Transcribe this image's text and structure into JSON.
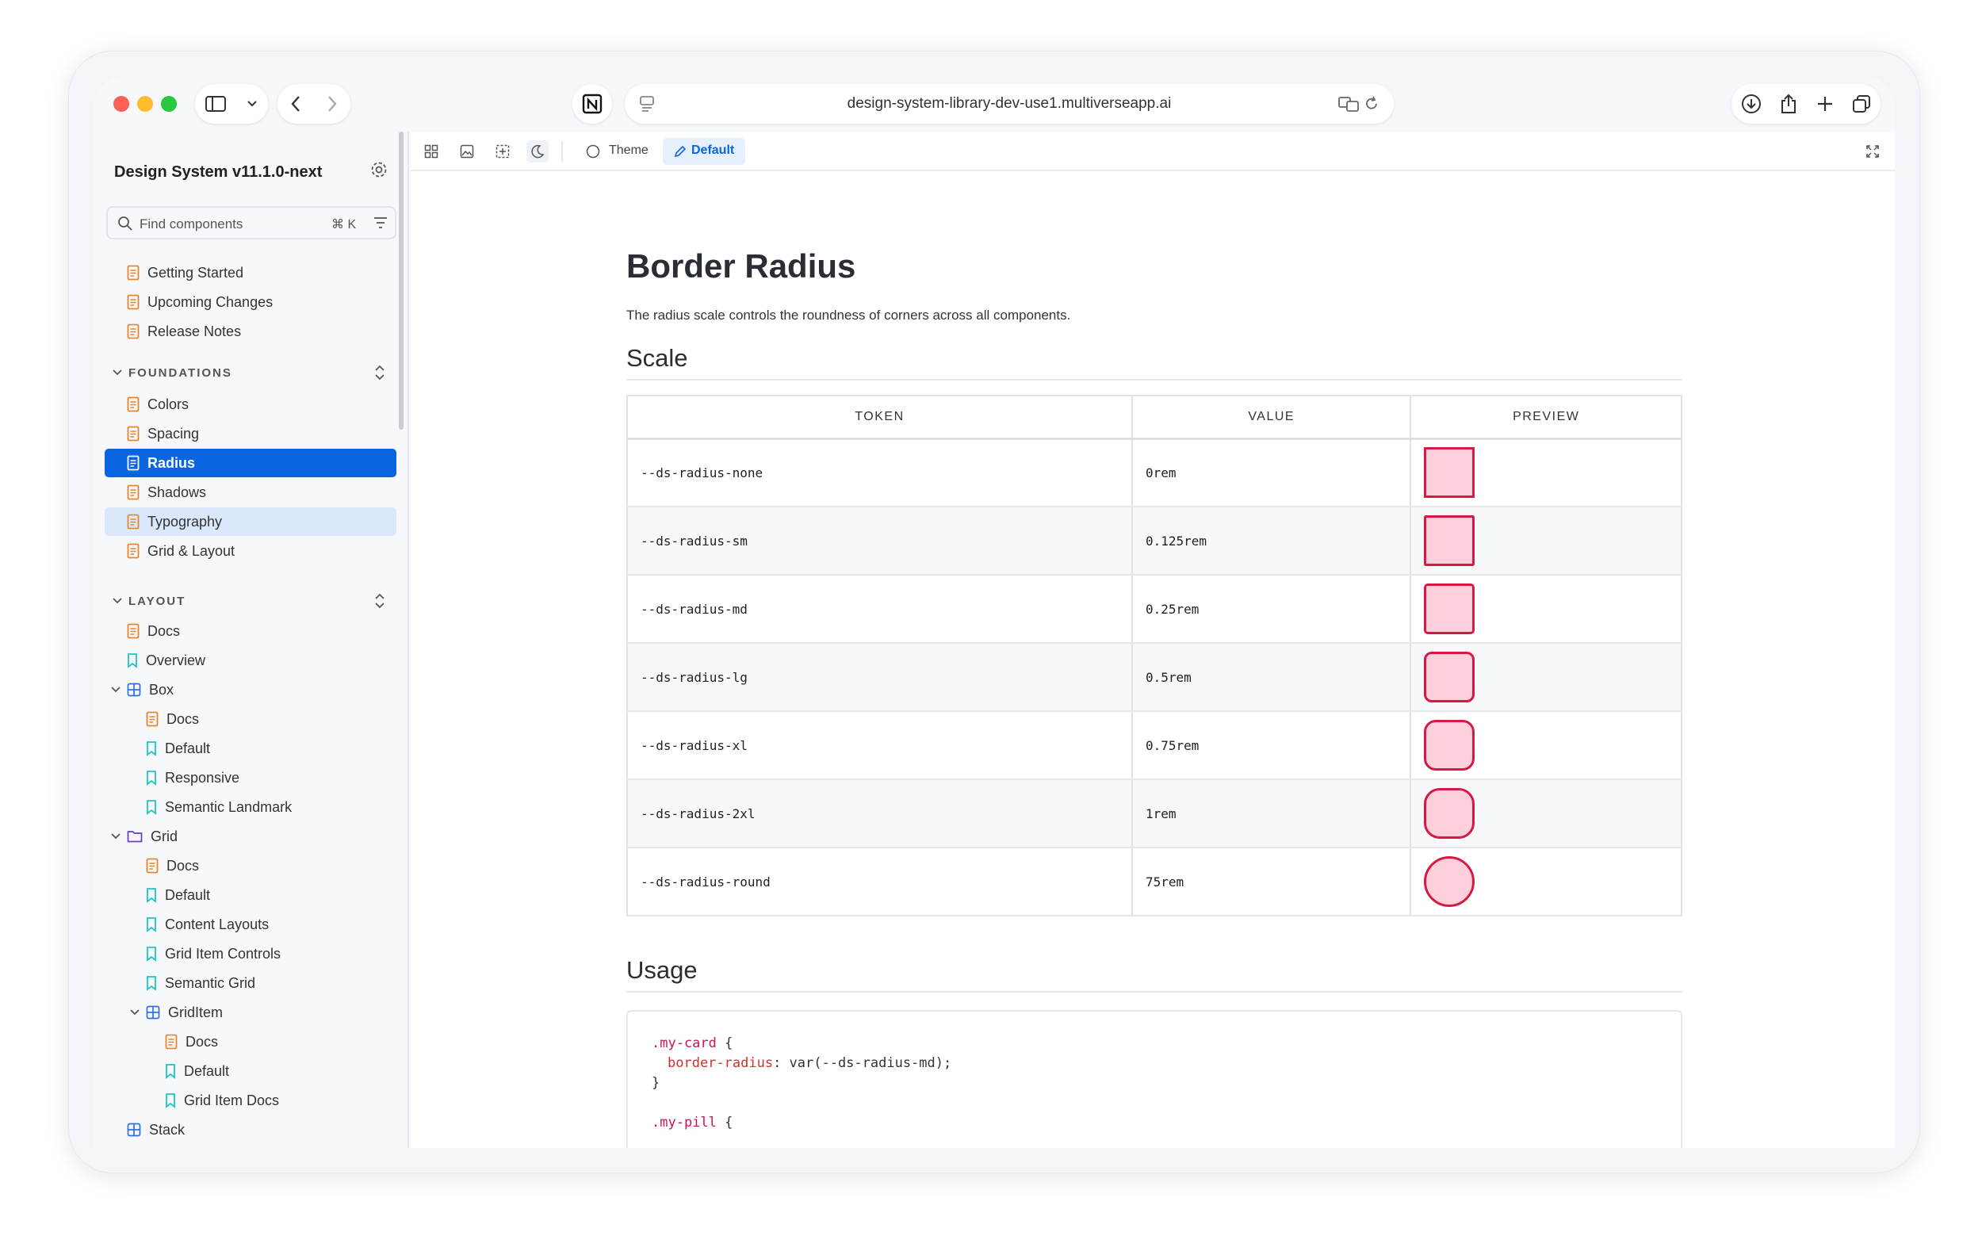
{
  "browser": {
    "url": "design-system-library-dev-use1.multiverseapp.ai"
  },
  "sidebar": {
    "title": "Design System v11.1.0-next",
    "search": {
      "placeholder": "Find components",
      "shortcut": "⌘ K"
    },
    "items": [
      {
        "label": "Getting Started",
        "icon": "document-icon",
        "y": 0
      },
      {
        "label": "Upcoming Changes",
        "icon": "document-icon"
      },
      {
        "label": "Release Notes",
        "icon": "document-icon"
      }
    ],
    "groups": {
      "foundations": {
        "label": "FOUNDATIONS",
        "items": [
          "Colors",
          "Spacing",
          "Radius",
          "Shadows",
          "Typography",
          "Grid & Layout"
        ]
      },
      "layout": {
        "label": "LAYOUT",
        "items": [
          "Docs",
          "Overview",
          "Box",
          "Docs",
          "Default",
          "Responsive",
          "Semantic Landmark",
          "Grid",
          "Docs",
          "Default",
          "Content Layouts",
          "Grid Item Controls",
          "Semantic Grid",
          "GridItem",
          "Docs",
          "Default",
          "Grid Item Docs",
          "Stack"
        ]
      }
    }
  },
  "toolbar": {
    "theme_label": "Theme",
    "default_label": "Default"
  },
  "page": {
    "title": "Border Radius",
    "lead": "The radius scale controls the roundness of corners across all components.",
    "scale_heading": "Scale",
    "usage_heading": "Usage",
    "table": {
      "headers": [
        "TOKEN",
        "VALUE",
        "PREVIEW"
      ],
      "rows": [
        {
          "token": "--ds-radius-none",
          "value": "0rem",
          "radius_rem": 0
        },
        {
          "token": "--ds-radius-sm",
          "value": "0.125rem",
          "radius_rem": 0.125
        },
        {
          "token": "--ds-radius-md",
          "value": "0.25rem",
          "radius_rem": 0.25
        },
        {
          "token": "--ds-radius-lg",
          "value": "0.5rem",
          "radius_rem": 0.5
        },
        {
          "token": "--ds-radius-xl",
          "value": "0.75rem",
          "radius_rem": 0.75
        },
        {
          "token": "--ds-radius-2xl",
          "value": "1rem",
          "radius_rem": 1
        },
        {
          "token": "--ds-radius-round",
          "value": "75rem",
          "radius_rem": 75
        }
      ]
    },
    "code": {
      "line1_selector": ".my-card",
      "line1_brace": " {",
      "line2_prop": "border-radius",
      "line2_value": ": var(--ds-radius-md);",
      "line3": "}",
      "line4_selector": ".my-pill",
      "line4_brace": " {"
    }
  },
  "colors": {
    "accent": "#0a66e0",
    "swatch_fill": "#fdd0dc",
    "swatch_border": "#d61a44"
  }
}
